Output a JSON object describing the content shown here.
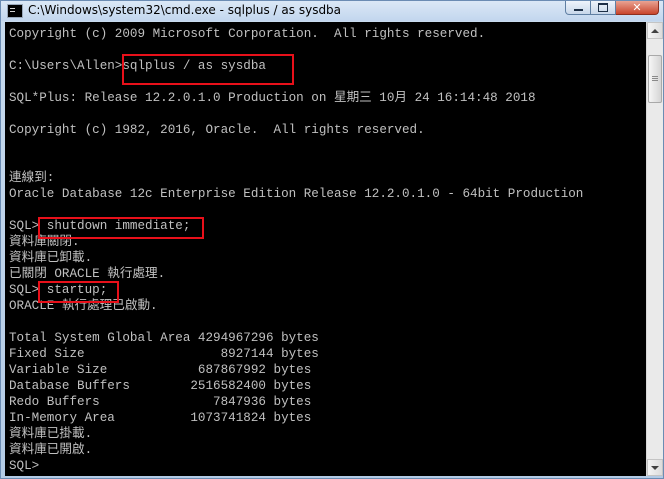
{
  "window": {
    "title": "C:\\Windows\\system32\\cmd.exe - sqlplus  / as sysdba",
    "minimize_label": "",
    "maximize_label": "",
    "close_label": "✕"
  },
  "console": {
    "lines": [
      "Copyright (c) 2009 Microsoft Corporation.  All rights reserved.",
      "",
      "C:\\Users\\Allen>sqlplus / as sysdba",
      "",
      "SQL*Plus: Release 12.2.0.1.0 Production on 星期三 10月 24 16:14:48 2018",
      "",
      "Copyright (c) 1982, 2016, Oracle.  All rights reserved.",
      "",
      "",
      "連線到:",
      "Oracle Database 12c Enterprise Edition Release 12.2.0.1.0 - 64bit Production",
      "",
      "SQL> shutdown immediate;",
      "資料庫關閉.",
      "資料庫已卸載.",
      "已關閉 ORACLE 執行處理.",
      "SQL> startup;",
      "ORACLE 執行處理已啟動.",
      "",
      "Total System Global Area 4294967296 bytes",
      "Fixed Size                  8927144 bytes",
      "Variable Size            687867992 bytes",
      "Database Buffers        2516582400 bytes",
      "Redo Buffers               7847936 bytes",
      "In-Memory Area          1073741824 bytes",
      "資料庫已掛載.",
      "資料庫已開啟.",
      "SQL>"
    ]
  },
  "colors": {
    "console_bg": "#000000",
    "console_text": "#c0c0c0",
    "highlight_border": "#e8101a"
  }
}
